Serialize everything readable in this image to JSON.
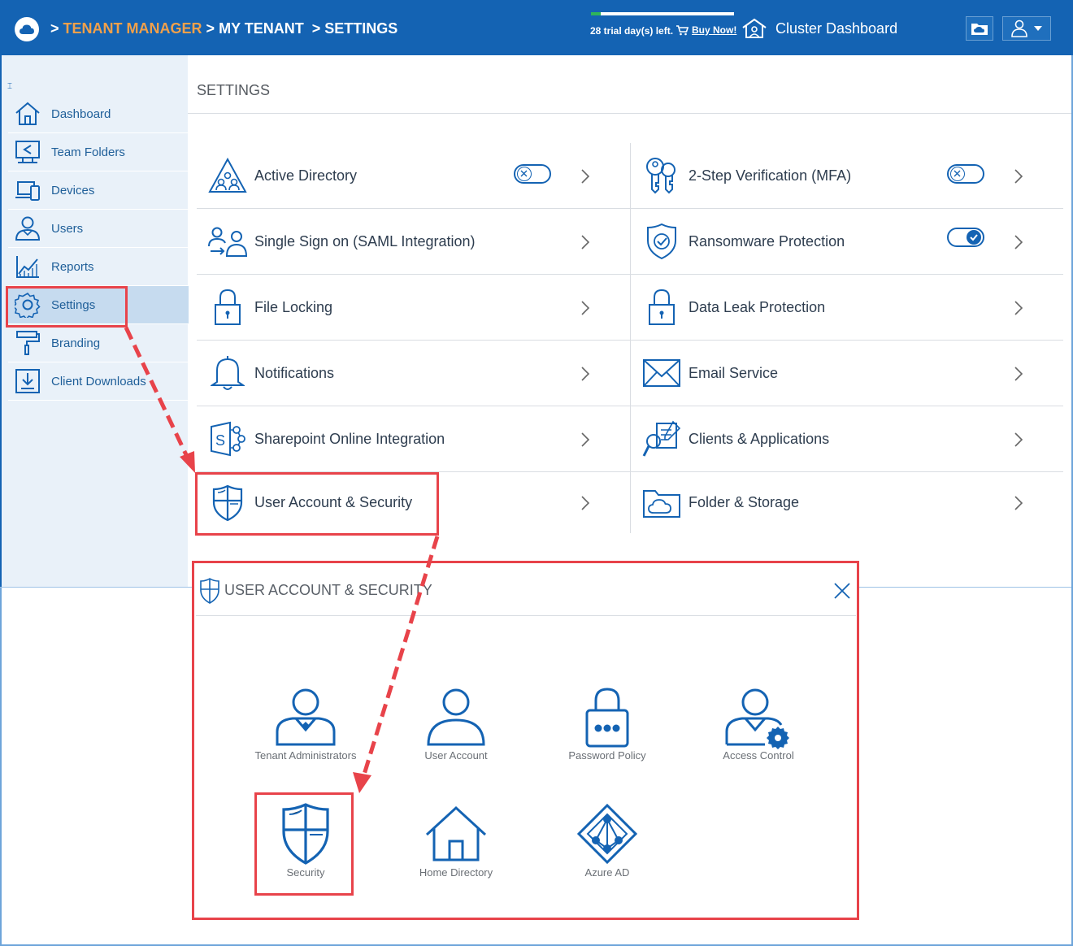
{
  "header": {
    "crumb_sep": ">",
    "crumb_1": "TENANT MANAGER",
    "crumb_2": "MY TENANT",
    "crumb_3": "SETTINGS",
    "trial_text": "28 trial day(s) left.",
    "buy_now": "Buy Now!",
    "cluster_dashboard": "Cluster Dashboard",
    "colors": {
      "bar": "#1463b3",
      "accent": "#f0a04b",
      "trial_fill": "#2fb45a"
    }
  },
  "sidebar": {
    "items": [
      {
        "label": "Dashboard",
        "icon": "home-icon"
      },
      {
        "label": "Team Folders",
        "icon": "team-folders-icon"
      },
      {
        "label": "Devices",
        "icon": "devices-icon"
      },
      {
        "label": "Users",
        "icon": "users-icon"
      },
      {
        "label": "Reports",
        "icon": "reports-icon"
      },
      {
        "label": "Settings",
        "icon": "gear-icon",
        "active": true
      },
      {
        "label": "Branding",
        "icon": "paint-roller-icon"
      },
      {
        "label": "Client Downloads",
        "icon": "download-icon"
      }
    ]
  },
  "main": {
    "title": "SETTINGS",
    "left": [
      {
        "label": "Active Directory",
        "icon": "active-directory-icon",
        "toggle": "off"
      },
      {
        "label": "Single Sign on (SAML Integration)",
        "icon": "sso-icon"
      },
      {
        "label": "File Locking",
        "icon": "lock-icon"
      },
      {
        "label": "Notifications",
        "icon": "bell-icon"
      },
      {
        "label": "Sharepoint Online Integration",
        "icon": "sharepoint-icon"
      },
      {
        "label": "User Account & Security",
        "icon": "shield-icon"
      }
    ],
    "right": [
      {
        "label": "2-Step Verification (MFA)",
        "icon": "keys-icon",
        "toggle": "off"
      },
      {
        "label": "Ransomware Protection",
        "icon": "shield-check-icon",
        "toggle": "on"
      },
      {
        "label": "Data Leak Protection",
        "icon": "lock-icon"
      },
      {
        "label": "Email Service",
        "icon": "envelope-icon"
      },
      {
        "label": "Clients & Applications",
        "icon": "clients-icon"
      },
      {
        "label": "Folder & Storage",
        "icon": "folder-cloud-icon"
      }
    ]
  },
  "dialog": {
    "title": "USER ACCOUNT & SECURITY",
    "tiles": [
      {
        "label": "Tenant Administrators",
        "icon": "admin-user-icon"
      },
      {
        "label": "User Account",
        "icon": "user-icon"
      },
      {
        "label": "Password Policy",
        "icon": "password-lock-icon"
      },
      {
        "label": "Access Control",
        "icon": "user-gear-icon"
      },
      {
        "label": "Security",
        "icon": "shield-icon"
      },
      {
        "label": "Home Directory",
        "icon": "house-icon"
      },
      {
        "label": "Azure AD",
        "icon": "azure-ad-icon"
      }
    ]
  },
  "annotation_color": "#e8434a"
}
